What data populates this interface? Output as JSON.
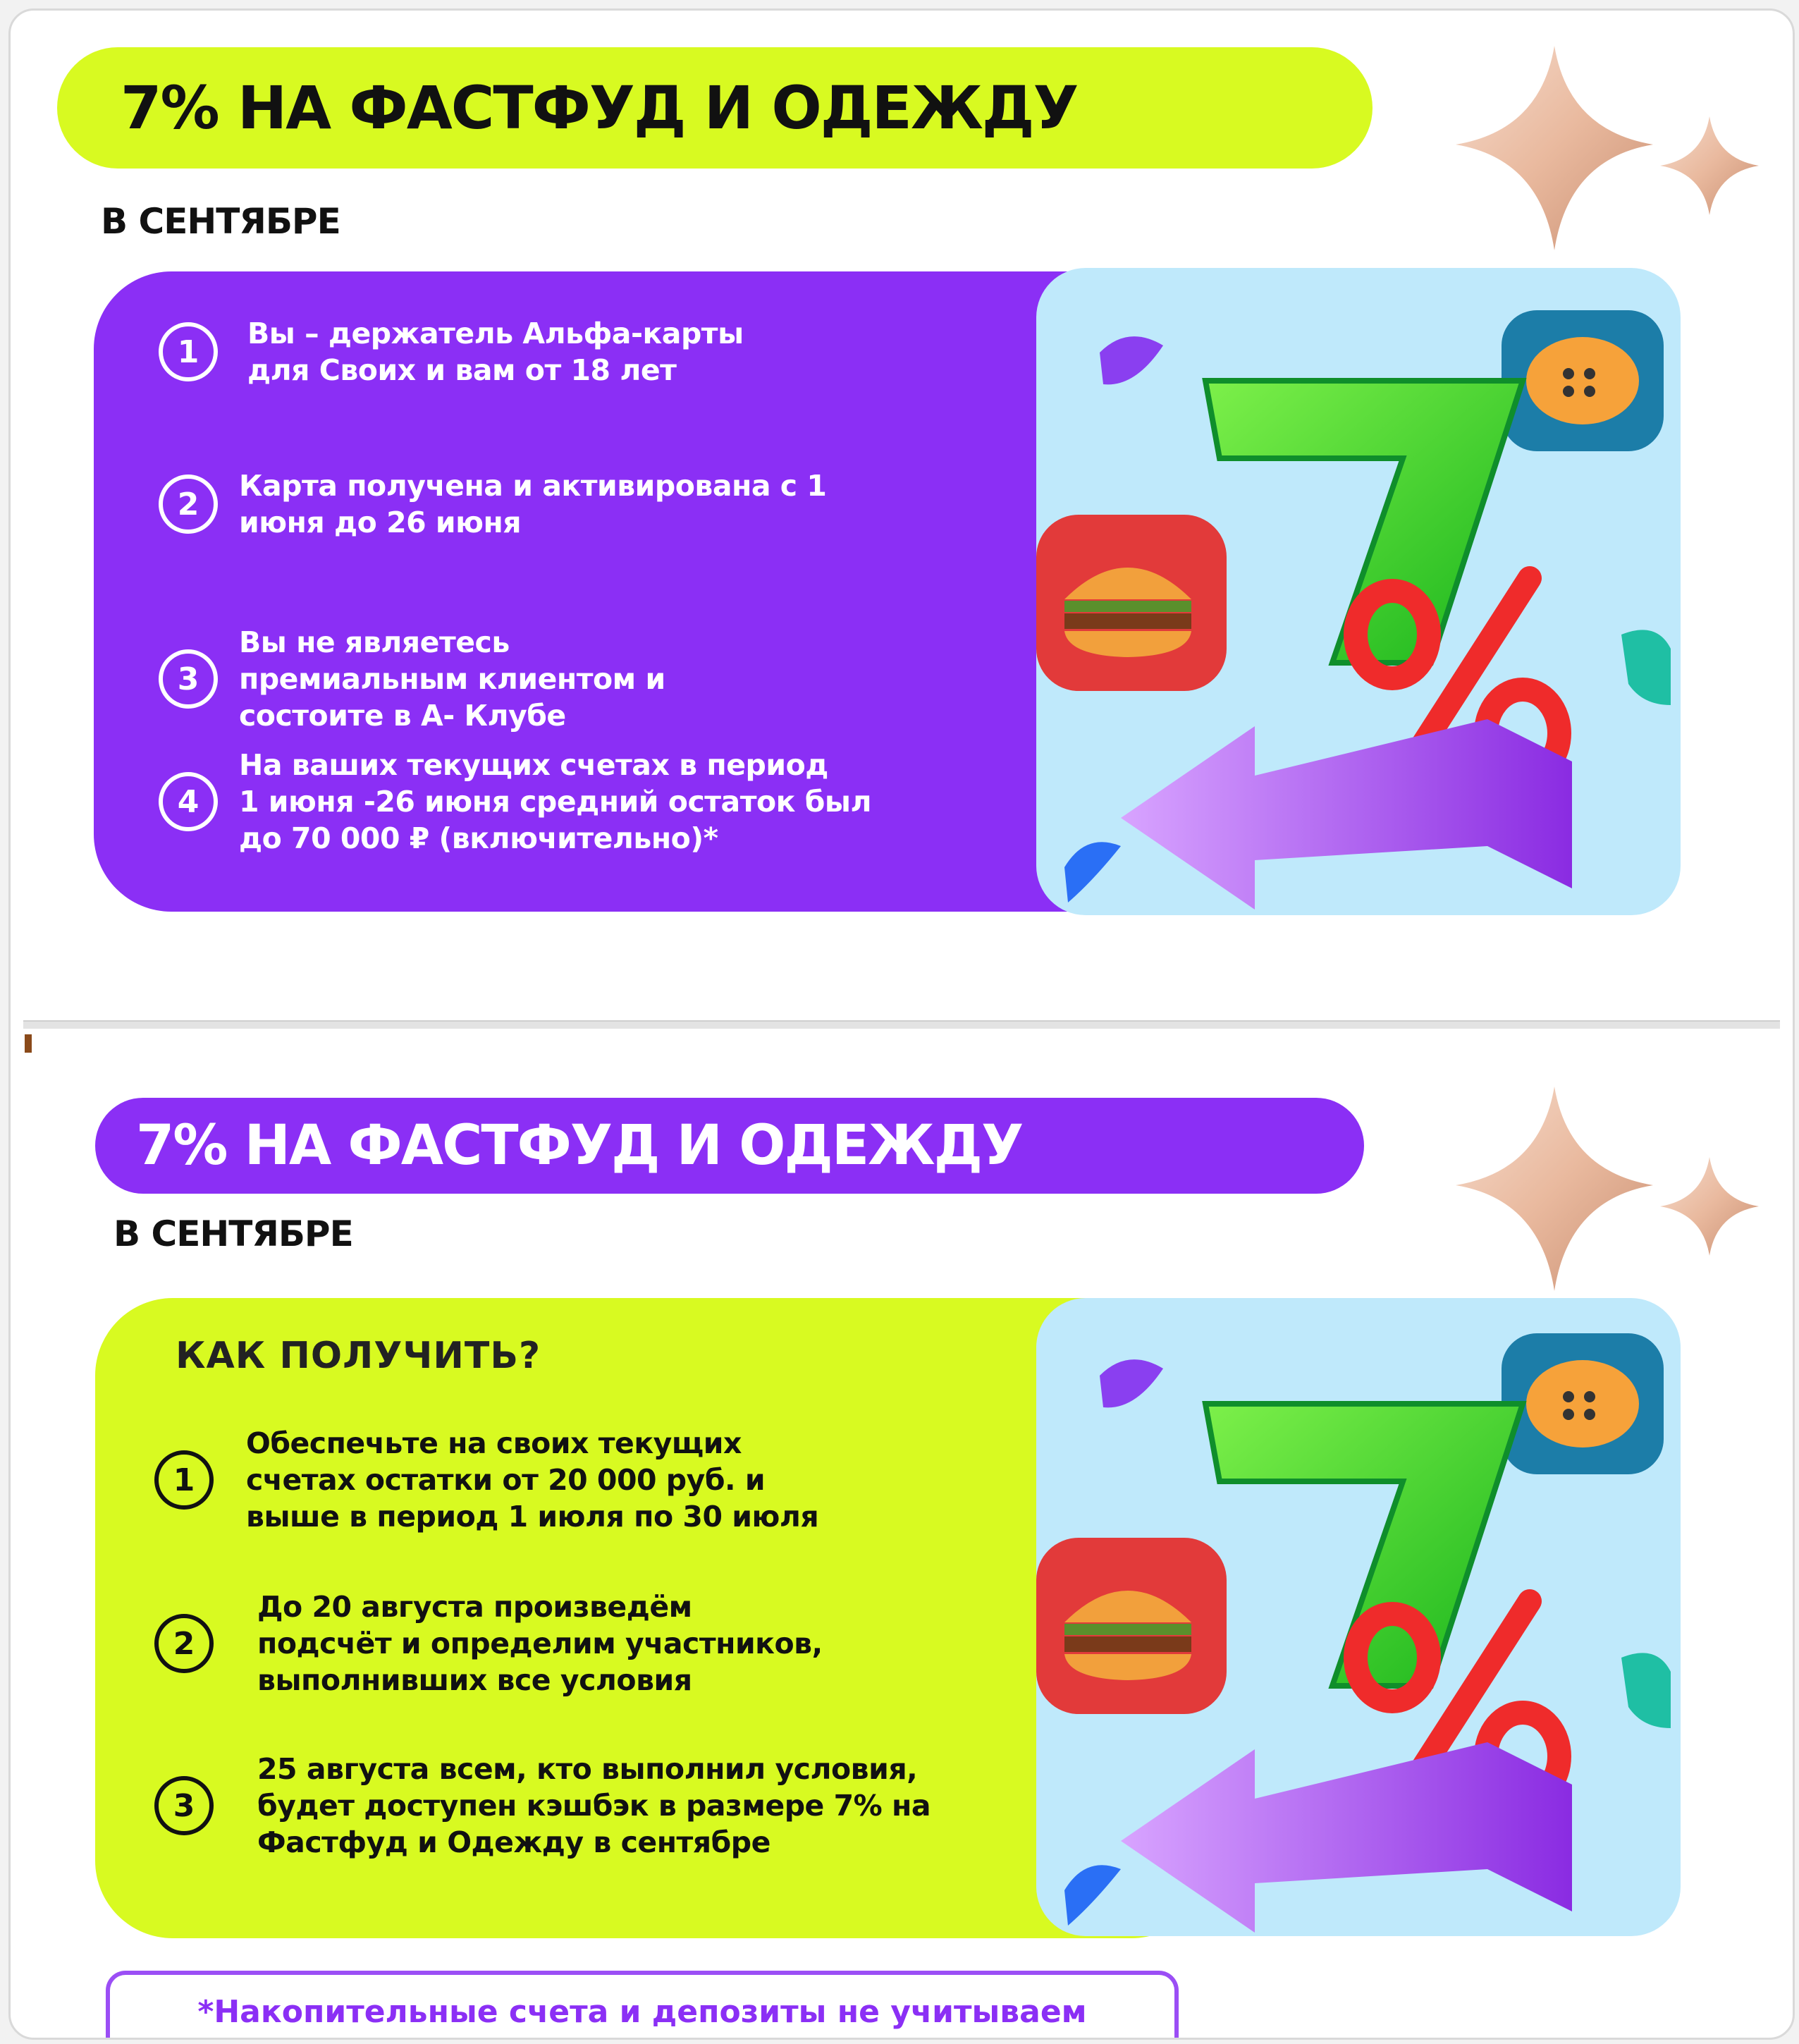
{
  "slides": [
    {
      "title": "7% НА ФАСТФУД И ОДЕЖДУ",
      "subtitle": "В СЕНТЯБРЕ",
      "steps": [
        {
          "num": "1",
          "text": "Вы – держатель Альфа-карты\nдля Своих и вам от 18 лет"
        },
        {
          "num": "2",
          "text": "Карта получена и активирована с 1\nиюня до 26 июня"
        },
        {
          "num": "3",
          "text": "Вы не являетесь\nпремиальным клиентом и\nсостоите в А- Клубе"
        },
        {
          "num": "4",
          "text": "На ваших текущих счетах в период\n1 июня -26 июня средний остаток был\nдо 70 000 ₽ (включительно)*"
        }
      ]
    },
    {
      "title": "7% НА ФАСТФУД И ОДЕЖДУ",
      "subtitle": "В СЕНТЯБРЕ",
      "heading": "КАК ПОЛУЧИТЬ?",
      "steps": [
        {
          "num": "1",
          "text": "Обеспечьте на своих текущих\nсчетах остатки от 20 000 руб. и\nвыше в период 1 июля по 30 июля"
        },
        {
          "num": "2",
          "text": "До 20 августа произведём\nподсчёт и определим участников,\nвыполнивших все условия"
        },
        {
          "num": "3",
          "text": "25 августа всем, кто выполнил условия,\nбудет доступен кэшбэк в размере 7% на\nФастфуд и Одежду в сентябре"
        }
      ],
      "footnote": "*Накопительные счета и депозиты не учитываем"
    }
  ],
  "art": {
    "big_text": "7",
    "percent_sign": "%",
    "icons": [
      "sparkle-icon",
      "burger-icon",
      "button-icon",
      "arrow-left-icon"
    ]
  },
  "colors": {
    "lime": "#d8fa21",
    "purple": "#8b2ff5",
    "sky": "#bfe9fb",
    "seven_green": "#37d61e",
    "percent_red": "#ef2b2b"
  }
}
